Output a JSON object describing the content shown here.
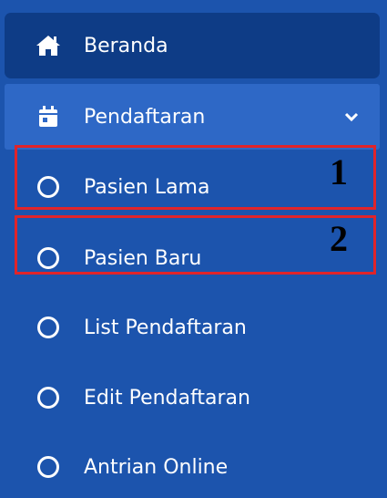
{
  "menu": {
    "beranda": {
      "label": "Beranda",
      "icon": "home-icon"
    },
    "pendaftaran": {
      "label": "Pendaftaran",
      "icon": "calendar-icon",
      "expanded": true
    },
    "submenu": [
      {
        "label": "Pasien Lama",
        "icon": "circle-icon"
      },
      {
        "label": "Pasien Baru",
        "icon": "circle-icon"
      },
      {
        "label": "List Pendaftaran",
        "icon": "circle-icon"
      },
      {
        "label": "Edit Pendaftaran",
        "icon": "circle-icon"
      },
      {
        "label": "Antrian Online",
        "icon": "circle-icon"
      }
    ]
  },
  "annotations": [
    {
      "number": "1",
      "target": "Pasien Lama"
    },
    {
      "number": "2",
      "target": "Pasien Baru"
    }
  ],
  "colors": {
    "sidebar_bg": "#1c54ad",
    "active_bg": "#0e3c86",
    "open_bg": "#2e68c6",
    "annotation": "#e0242a"
  }
}
